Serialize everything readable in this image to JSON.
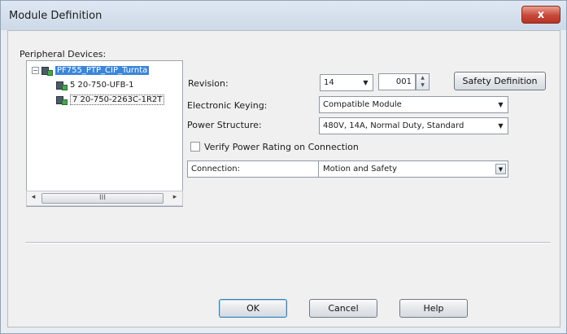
{
  "window": {
    "title": "Module Definition",
    "close_glyph": "x"
  },
  "peripheral": {
    "label": "Peripheral Devices:",
    "root": {
      "expander": "−",
      "label": "PF755_PTP_CIP_Turnta"
    },
    "children": [
      {
        "label": "5 20-750-UFB-1"
      },
      {
        "label": "7 20-750-2263C-1R2T"
      }
    ],
    "scroll": {
      "left": "◂",
      "thumb": "III",
      "right": "▸"
    }
  },
  "form": {
    "revision_label": "Revision:",
    "revision_major": "14",
    "revision_minor": "001",
    "safety_button": "Safety Definition",
    "keying_label": "Electronic Keying:",
    "keying_value": "Compatible Module",
    "power_label": "Power Structure:",
    "power_value": "480V, 14A, Normal Duty, Standard",
    "verify_label": "Verify Power Rating on Connection",
    "connection_label": "Connection:",
    "connection_value": "Motion and Safety"
  },
  "buttons": {
    "ok": "OK",
    "cancel": "Cancel",
    "help": "Help"
  },
  "glyphs": {
    "dropdown": "▼",
    "spin_up": "▲",
    "spin_down": "▼"
  },
  "colors": {
    "selection": "#3b86d8",
    "close": "#c6493a"
  }
}
